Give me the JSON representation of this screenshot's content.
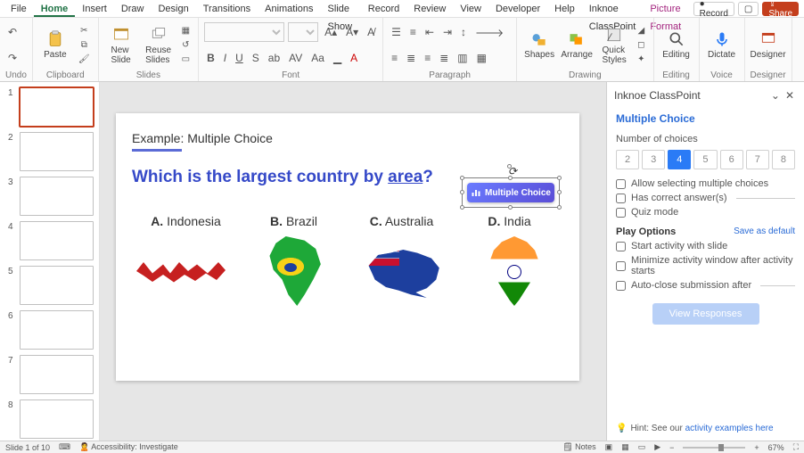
{
  "tabs": [
    "File",
    "Home",
    "Insert",
    "Draw",
    "Design",
    "Transitions",
    "Animations",
    "Slide Show",
    "Record",
    "Review",
    "View",
    "Developer",
    "Help",
    "Inknoe ClassPoint"
  ],
  "active_tab_index": 1,
  "contextual_tab": "Picture Format",
  "topright": {
    "record": "Record",
    "share": "Share"
  },
  "ribbon": {
    "undo": "Undo",
    "paste": "Paste",
    "clipboard_cap": "Clipboard",
    "new_slide": "New\nSlide",
    "reuse_slides": "Reuse\nSlides",
    "slides_cap": "Slides",
    "font_cap": "Font",
    "para_cap": "Paragraph",
    "shapes": "Shapes",
    "arrange": "Arrange",
    "quick_styles": "Quick\nStyles",
    "drawing_cap": "Drawing",
    "editing": "Editing",
    "editing_cap": "Editing",
    "dictate": "Dictate",
    "voice_cap": "Voice",
    "designer": "Designer",
    "designer_cap": "Designer"
  },
  "slide": {
    "caption": "Example: Multiple Choice",
    "question_pre": "Which is the largest country by ",
    "question_area": "area",
    "question_post": "?",
    "opts": {
      "a_l": "A.",
      "a": "Indonesia",
      "b_l": "B.",
      "b": "Brazil",
      "c_l": "C.",
      "c": "Australia",
      "d_l": "D.",
      "d": "India"
    },
    "badge": "Multiple Choice"
  },
  "pane": {
    "title": "Inknoe ClassPoint",
    "subtitle": "Multiple Choice",
    "num_choices_label": "Number of choices",
    "choice_values": [
      "2",
      "3",
      "4",
      "5",
      "6",
      "7",
      "8"
    ],
    "selected_choice": "4",
    "allow_multi": "Allow selecting multiple choices",
    "has_correct": "Has correct answer(s)",
    "quiz_mode": "Quiz mode",
    "play_options": "Play Options",
    "save_default": "Save as default",
    "start_with_slide": "Start activity with slide",
    "minimize_after": "Minimize activity window after activity starts",
    "auto_close": "Auto-close submission after",
    "view_responses": "View Responses",
    "hint_pre": "Hint: See our ",
    "hint_link": "activity examples here"
  },
  "status": {
    "slide_n": "Slide 1 of 10",
    "accessibility": "Accessibility: Investigate",
    "notes": "Notes",
    "zoom": "67%"
  }
}
